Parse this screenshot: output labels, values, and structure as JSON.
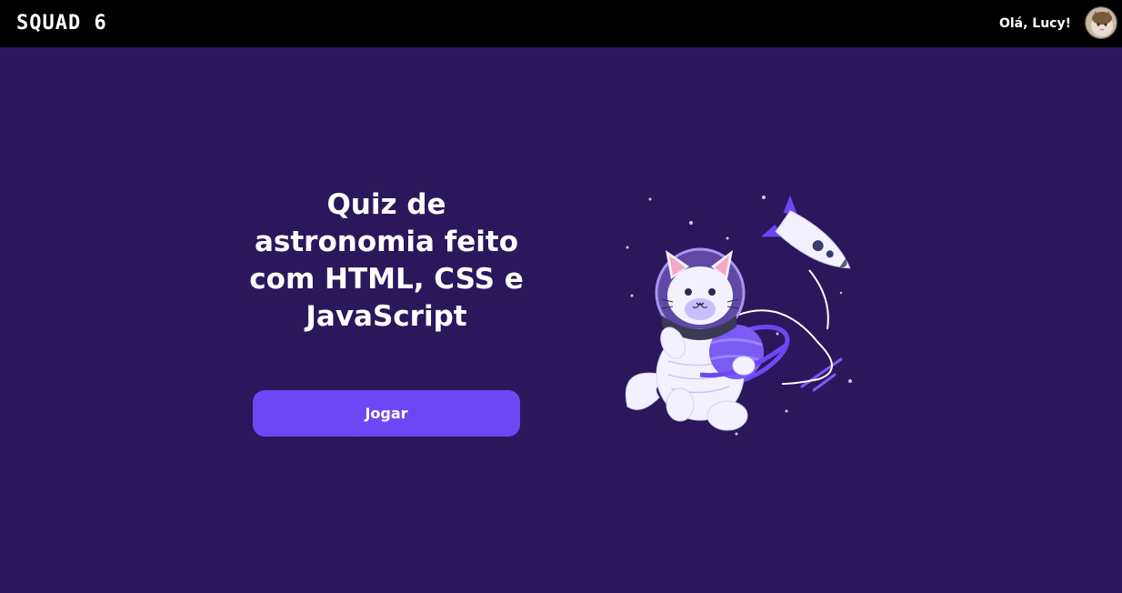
{
  "header": {
    "logo_text": "SQUAD 6",
    "greeting": "Olá, Lucy!"
  },
  "hero": {
    "title": "Quiz de astronomia feito com HTML, CSS e JavaScript",
    "play_button_label": "Jogar"
  },
  "colors": {
    "background": "#2b175c",
    "header": "#000000",
    "button": "#6c48f5",
    "text": "#ffffff"
  },
  "icons": {
    "avatar": "user-avatar-cat-photo",
    "illustration": "astronaut-cat-with-rocket"
  }
}
